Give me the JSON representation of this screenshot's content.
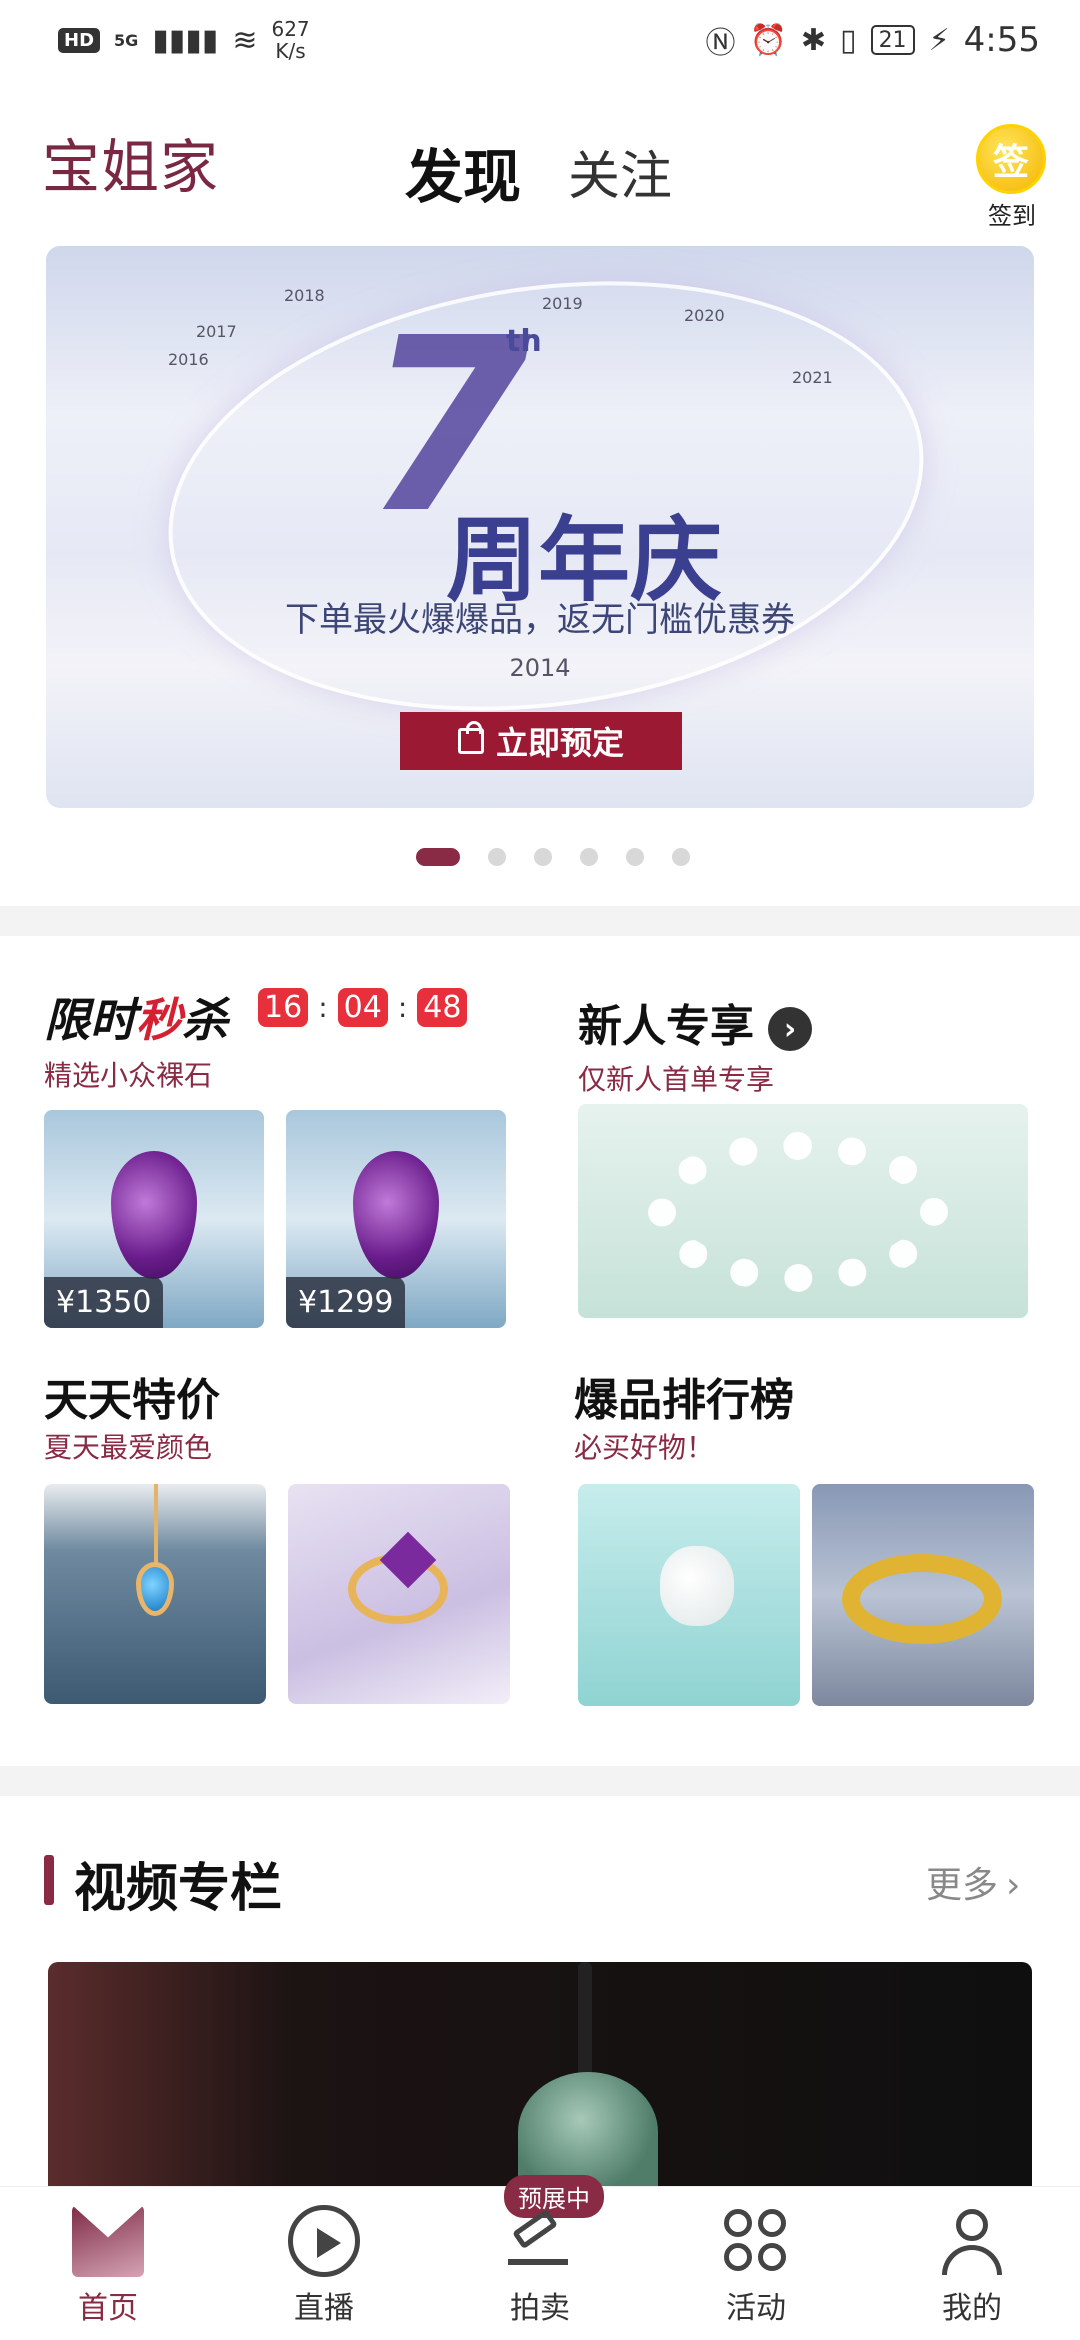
{
  "status_bar": {
    "network_badge": "HD",
    "network_type": "5G",
    "speed_value": "627",
    "speed_unit": "K/s",
    "battery": "21",
    "time": "4:55"
  },
  "header": {
    "logo": "宝姐家",
    "tabs": [
      {
        "label": "发现",
        "active": true
      },
      {
        "label": "关注",
        "active": false
      }
    ],
    "signin_icon_text": "签",
    "signin_label": "签到"
  },
  "banner": {
    "big_number": "7",
    "superscript": "th",
    "title": "周年庆",
    "subtitle": "下单最火爆爆品，返无门槛优惠券",
    "years": [
      "2014",
      "2016",
      "2017",
      "2018",
      "2019",
      "2020",
      "2021"
    ],
    "button_label": "立即预定",
    "page_count": 6,
    "active_page": 1
  },
  "flash_sale": {
    "title_part1": "限时",
    "title_part2": "秒",
    "title_part3": "杀",
    "countdown": [
      "16",
      "04",
      "48"
    ],
    "separator": ":",
    "subtitle": "精选小众裸石",
    "items": [
      {
        "price": "¥1350",
        "image": "amethyst-drop"
      },
      {
        "price": "¥1299",
        "image": "amethyst-drop"
      }
    ]
  },
  "newbie": {
    "title": "新人专享",
    "subtitle": "仅新人首单专享",
    "image": "moonstone-bracelet"
  },
  "daily_deal": {
    "title": "天天特价",
    "subtitle": "夏天最爱颜色",
    "images": [
      "topaz-necklace",
      "amethyst-ring"
    ]
  },
  "bestseller": {
    "title": "爆品排行榜",
    "subtitle": "必买好物！",
    "images": [
      "white-jade-ring",
      "gold-bangle"
    ]
  },
  "video_section": {
    "title": "视频专栏",
    "more_label": "更多",
    "image": "jade-pendant"
  },
  "bottom_nav": {
    "items": [
      {
        "label": "首页",
        "icon": "home-icon",
        "active": true
      },
      {
        "label": "直播",
        "icon": "live-icon",
        "active": false
      },
      {
        "label": "拍卖",
        "icon": "auction-icon",
        "active": false,
        "badge": "预展中"
      },
      {
        "label": "活动",
        "icon": "activity-icon",
        "active": false
      },
      {
        "label": "我的",
        "icon": "profile-icon",
        "active": false
      }
    ]
  },
  "colors": {
    "brand": "#8a2b45",
    "banner_button": "#9b1933",
    "countdown": "#e8303c"
  }
}
